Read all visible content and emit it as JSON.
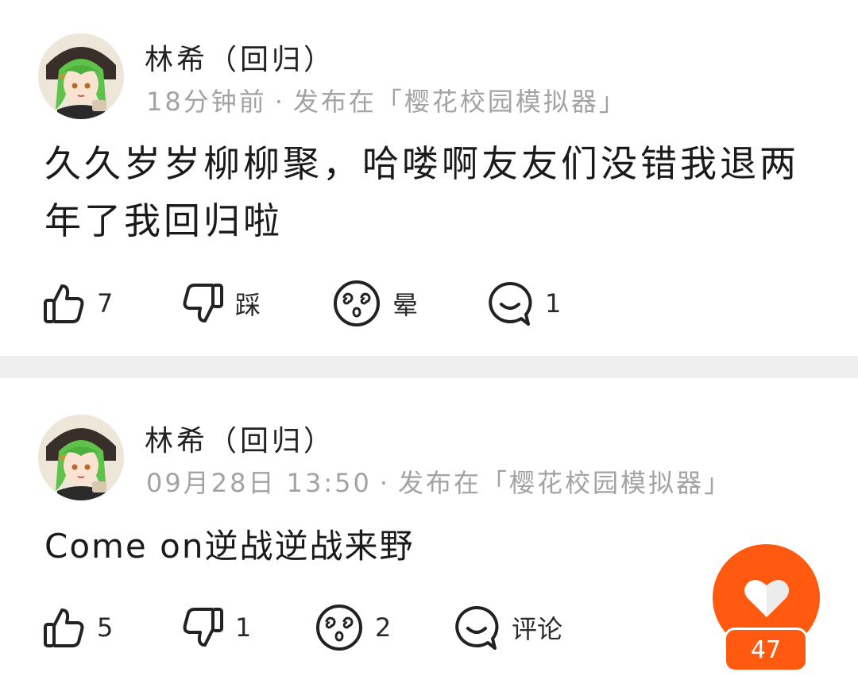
{
  "posts": [
    {
      "author": "林希（回归）",
      "time": "18分钟前",
      "separator": "·",
      "published_in": "发布在「樱花校园模拟器」",
      "content": "久久岁岁柳柳聚，哈喽啊友友们没错我退两年了我回归啦",
      "actions": {
        "like": "7",
        "dislike": "踩",
        "dizzy": "晕",
        "comment": "1"
      }
    },
    {
      "author": "林希（回归）",
      "time": "09月28日 13:50",
      "separator": "·",
      "published_in": "发布在「樱花校园模拟器」",
      "content": "Come on逆战逆战来野",
      "actions": {
        "like": "5",
        "dislike": "1",
        "dizzy": "2",
        "comment": "评论"
      }
    }
  ],
  "floating_like": {
    "count": "47",
    "icon": "heart-icon"
  },
  "colors": {
    "accent": "#ff5a0f",
    "divider": "#efefef",
    "meta_text": "#a3a3a3"
  }
}
